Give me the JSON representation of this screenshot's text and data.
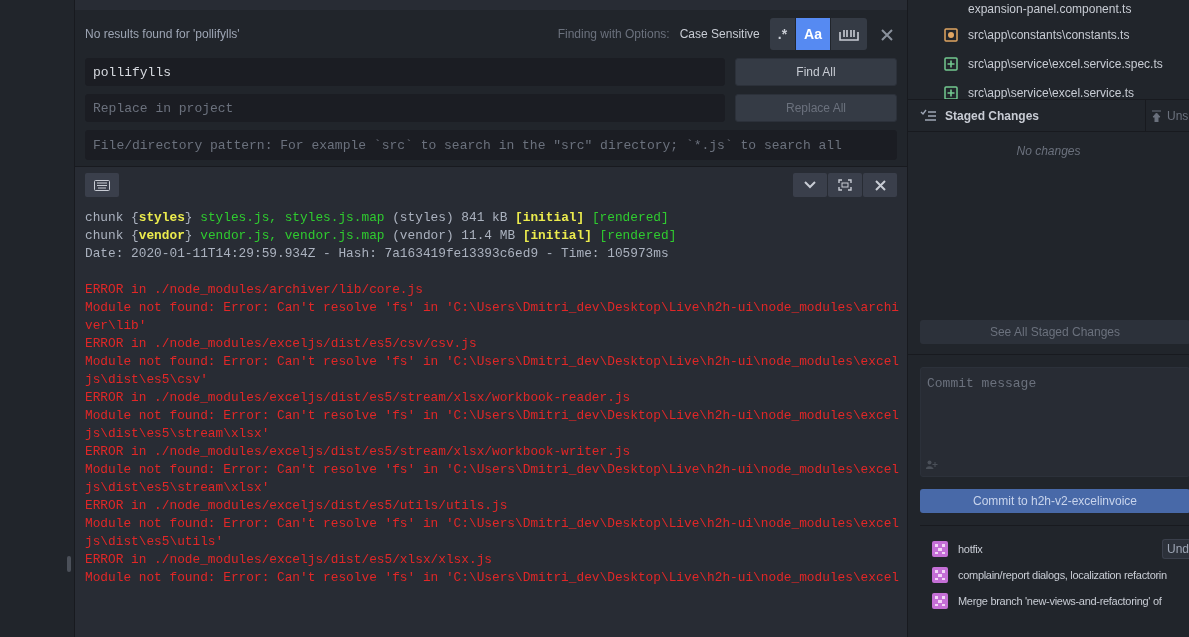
{
  "find_panel": {
    "status": "No results found for 'pollifylls'",
    "options_label": "Finding with Options:",
    "options_value": "Case Sensitive",
    "toggles": [
      {
        "kind": "regex",
        "label": ".*",
        "selected": false
      },
      {
        "kind": "case",
        "label": "Aa",
        "selected": true
      },
      {
        "kind": "word",
        "selected": false
      }
    ],
    "find": {
      "value": "pollifylls"
    },
    "find_button": "Find All",
    "replace": {
      "placeholder": "Replace in project"
    },
    "replace_button": {
      "label": "Replace All",
      "disabled": true
    },
    "paths": {
      "placeholder": "File/directory pattern: For example `src` to search in the \"src\" directory; `*.js` to search all"
    }
  },
  "terminal": {
    "lines": [
      [
        {
          "kind": "plain",
          "text": "chunk {"
        },
        {
          "kind": "bold",
          "text": "styles"
        },
        {
          "kind": "plain",
          "text": "} "
        },
        {
          "kind": "green",
          "text": "styles.js, styles.js.map"
        },
        {
          "kind": "plain",
          "text": " (styles) 841 kB "
        },
        {
          "kind": "bold",
          "text": "[initial]"
        },
        {
          "kind": "green",
          "text": " [rendered]"
        }
      ],
      [
        {
          "kind": "plain",
          "text": "chunk {"
        },
        {
          "kind": "bold",
          "text": "vendor"
        },
        {
          "kind": "plain",
          "text": "} "
        },
        {
          "kind": "green",
          "text": "vendor.js, vendor.js.map"
        },
        {
          "kind": "plain",
          "text": " (vendor) 11.4 MB "
        },
        {
          "kind": "bold",
          "text": "[initial]"
        },
        {
          "kind": "green",
          "text": " [rendered]"
        }
      ],
      [
        {
          "kind": "plain",
          "text": "Date: 2020-01-11T14:29:59.934Z - Hash: 7a163419fe13393c6ed9 - Time: 105973ms"
        },
        {
          "kind": "gap"
        }
      ],
      [
        {
          "kind": "error",
          "text": "ERROR in ./node_modules/archiver/lib/core.js"
        }
      ],
      [
        {
          "kind": "error",
          "text": "Module not found: Error: Can't resolve 'fs' in 'C:\\Users\\Dmitri_dev\\Desktop\\Live\\h2h-ui\\node_modules\\archi"
        }
      ],
      [
        {
          "kind": "error",
          "text": "ver\\lib'"
        }
      ],
      [
        {
          "kind": "error",
          "text": "ERROR in ./node_modules/exceljs/dist/es5/csv/csv.js"
        }
      ],
      [
        {
          "kind": "error",
          "text": "Module not found: Error: Can't resolve 'fs' in 'C:\\Users\\Dmitri_dev\\Desktop\\Live\\h2h-ui\\node_modules\\excel"
        }
      ],
      [
        {
          "kind": "error",
          "text": "js\\dist\\es5\\csv'"
        }
      ],
      [
        {
          "kind": "error",
          "text": "ERROR in ./node_modules/exceljs/dist/es5/stream/xlsx/workbook-reader.js"
        }
      ],
      [
        {
          "kind": "error",
          "text": "Module not found: Error: Can't resolve 'fs' in 'C:\\Users\\Dmitri_dev\\Desktop\\Live\\h2h-ui\\node_modules\\excel"
        }
      ],
      [
        {
          "kind": "error",
          "text": "js\\dist\\es5\\stream\\xlsx'"
        }
      ],
      [
        {
          "kind": "error",
          "text": "ERROR in ./node_modules/exceljs/dist/es5/stream/xlsx/workbook-writer.js"
        }
      ],
      [
        {
          "kind": "error",
          "text": "Module not found: Error: Can't resolve 'fs' in 'C:\\Users\\Dmitri_dev\\Desktop\\Live\\h2h-ui\\node_modules\\excel"
        }
      ],
      [
        {
          "kind": "error",
          "text": "js\\dist\\es5\\stream\\xlsx'"
        }
      ],
      [
        {
          "kind": "error",
          "text": "ERROR in ./node_modules/exceljs/dist/es5/utils/utils.js"
        }
      ],
      [
        {
          "kind": "error",
          "text": "Module not found: Error: Can't resolve 'fs' in 'C:\\Users\\Dmitri_dev\\Desktop\\Live\\h2h-ui\\node_modules\\excel"
        }
      ],
      [
        {
          "kind": "error",
          "text": "js\\dist\\es5\\utils'"
        }
      ],
      [
        {
          "kind": "error",
          "text": "ERROR in ./node_modules/exceljs/dist/es5/xlsx/xlsx.js"
        }
      ],
      [
        {
          "kind": "error",
          "text": "Module not found: Error: Can't resolve 'fs' in 'C:\\Users\\Dmitri_dev\\Desktop\\Live\\h2h-ui\\node_modules\\excel"
        }
      ]
    ]
  },
  "git": {
    "files": [
      {
        "kind": "none",
        "name": "expansion-panel.component.ts"
      },
      {
        "kind": "modified",
        "name": "src\\app\\constants\\constants.ts"
      },
      {
        "kind": "added",
        "name": "src\\app\\service\\excel.service.spec.ts"
      },
      {
        "kind": "added",
        "name": "src\\app\\service\\excel.service.ts"
      }
    ],
    "staged_title": "Staged Changes",
    "unstage_button": "Uns",
    "staged_empty": "No changes",
    "see_all_button": "See All Staged Changes",
    "commit_message": {
      "placeholder": "Commit message"
    },
    "commit_button": "Commit to h2h-v2-excelinvoice",
    "commits": [
      {
        "message": "hotfix",
        "undo": "Und"
      },
      {
        "message": "complain/report dialogs, localization refactorin"
      },
      {
        "message": "Merge branch 'new-views-and-refactoring' of"
      }
    ]
  }
}
